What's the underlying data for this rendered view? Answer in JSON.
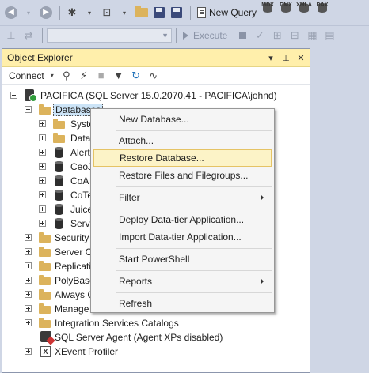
{
  "toolbar": {
    "new_query_label": "New Query",
    "query_types": [
      "MDX",
      "DMX",
      "XMLA",
      "DAX"
    ],
    "execute_label": "Execute"
  },
  "object_explorer": {
    "title": "Object Explorer",
    "connect_label": "Connect",
    "server_node": "PACIFICA (SQL Server 15.0.2070.41 - PACIFICA\\johnd)",
    "databases_node": "Databases",
    "database_children": [
      "Syste",
      "Data",
      "Alert",
      "CeoJ",
      "CoA",
      "CoTe",
      "Juice",
      "Servi"
    ],
    "server_children": [
      "Security",
      "Server O",
      "Replicati",
      "PolyBase",
      "Always C",
      "Manage",
      "Integration Services Catalogs",
      "SQL Server Agent (Agent XPs disabled)",
      "XEvent Profiler"
    ]
  },
  "context_menu": {
    "items": [
      "New Database...",
      "Attach...",
      "Restore Database...",
      "Restore Files and Filegroups...",
      "Filter",
      "Deploy Data-tier Application...",
      "Import Data-tier Application...",
      "Start PowerShell",
      "Reports",
      "Refresh"
    ],
    "highlighted": "Restore Database..."
  },
  "colors": {
    "panel_title_bg": "#ffefab",
    "menu_highlight_bg": "#fcf3c7",
    "selection_bg": "#cce4f7",
    "chrome_bg": "#cfd6e5"
  }
}
